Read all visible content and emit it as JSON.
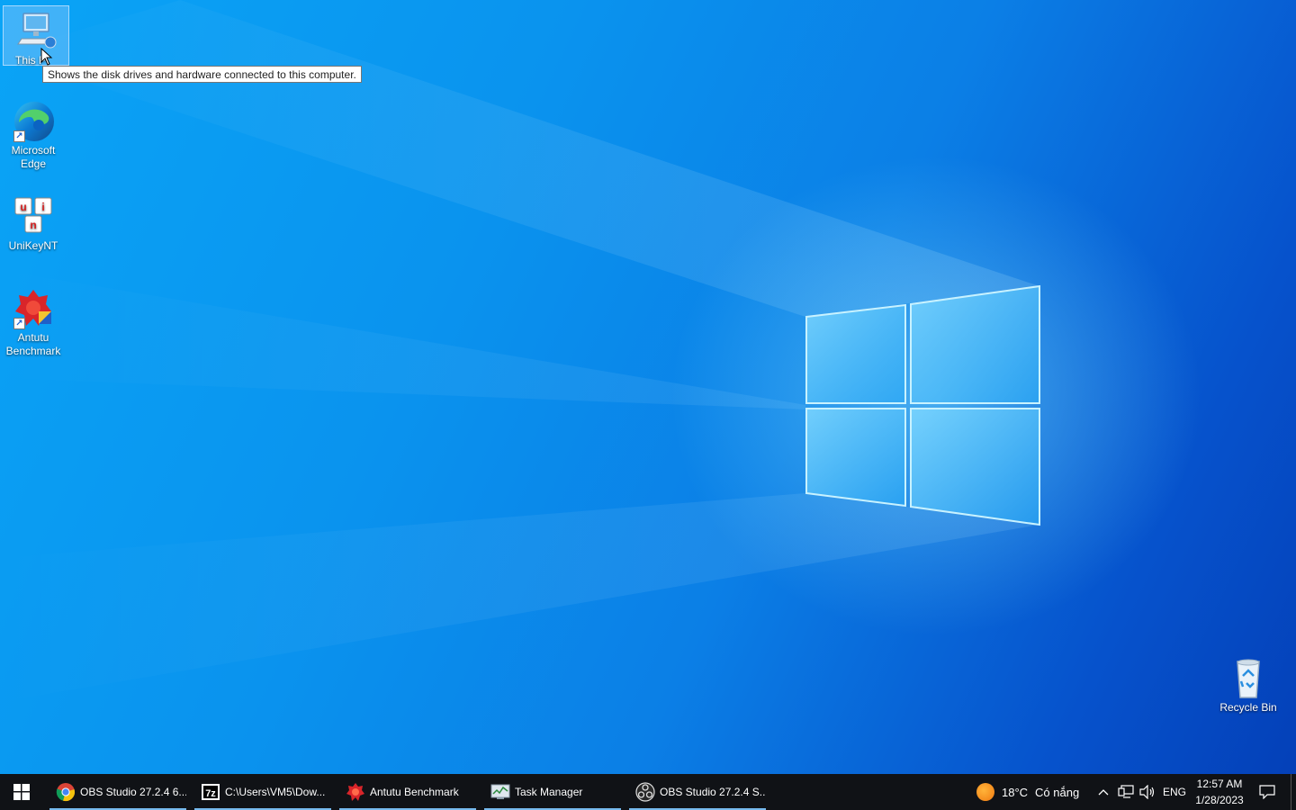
{
  "desktop": {
    "icons": [
      {
        "label": "This PC"
      },
      {
        "label": "Microsoft Edge"
      },
      {
        "label": "UniKeyNT"
      },
      {
        "label": "Antutu Benchmark"
      },
      {
        "label": "Recycle Bin"
      }
    ],
    "tooltip": "Shows the disk drives and hardware connected to this computer.",
    "this_pc_visible": "This P"
  },
  "taskbar": {
    "start_icon": "windows-logo-icon",
    "buttons": [
      {
        "label": "OBS Studio 27.2.4 6...",
        "icon": "chrome-icon",
        "active": true
      },
      {
        "label": "C:\\Users\\VM5\\Dow...",
        "icon": "7zip-icon",
        "active": true
      },
      {
        "label": "Antutu Benchmark",
        "icon": "antutu-icon",
        "active": true
      },
      {
        "label": "Task Manager",
        "icon": "task-manager-icon",
        "active": true
      },
      {
        "label": "OBS Studio 27.2.4 S...",
        "icon": "obs-icon",
        "active": true
      }
    ],
    "weather": {
      "temp": "18°C",
      "condition": "Có nắng"
    },
    "language": "ENG",
    "time": "12:57 AM",
    "date": "1/28/2023"
  },
  "colors": {
    "taskbar_bg": "#101216",
    "task_underline": "#76b9ed",
    "wallpaper_blue": "#0a93ee"
  }
}
